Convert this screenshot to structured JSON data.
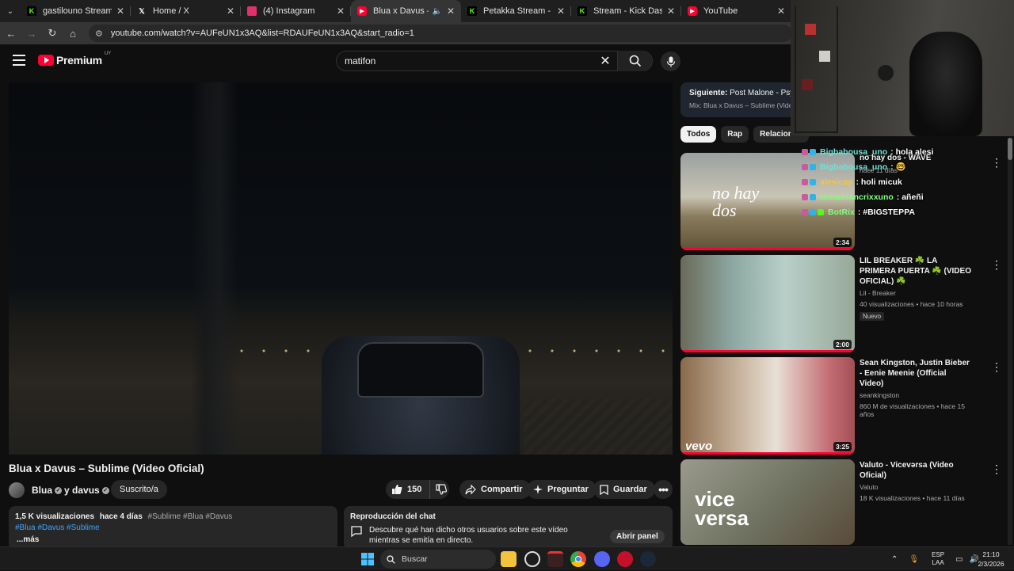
{
  "browser": {
    "tabs": [
      {
        "title": "gastilouno Stream - Watch",
        "icon": "kick-icon",
        "color": "#53fc18",
        "active": false
      },
      {
        "title": "Home / X",
        "icon": "x-icon",
        "color": "#ffffff",
        "active": false
      },
      {
        "title": "(4) Instagram",
        "icon": "instagram-icon",
        "color": "#e1306c",
        "active": false
      },
      {
        "title": "Blua x Davus – Sublime",
        "icon": "youtube-icon",
        "color": "#ff0033",
        "active": true
      },
      {
        "title": "Petakka Stream - Watch L",
        "icon": "kick-icon",
        "color": "#53fc18",
        "active": false
      },
      {
        "title": "Stream - Kick Dashboard",
        "icon": "kick-icon",
        "color": "#53fc18",
        "active": false
      },
      {
        "title": "YouTube",
        "icon": "youtube-icon",
        "color": "#ff0033",
        "active": false
      }
    ],
    "url": "youtube.com/watch?v=AUFeUN1x3AQ&list=RDAUFeUN1x3AQ&start_radio=1"
  },
  "header": {
    "logo_text": "Premium",
    "country_code": "UY",
    "search_query": "matifon"
  },
  "video": {
    "title": "Blua x Davus – Sublime (Video Oficial)",
    "channel": "Blua",
    "channel_joiner": "y davus",
    "subscribed_label": "Suscrito/a",
    "likes": "150",
    "share_label": "Compartir",
    "ask_label": "Preguntar",
    "save_label": "Guardar"
  },
  "description": {
    "views": "1,5 K visualizaciones",
    "age": "hace 4 días",
    "tags_inline": "#Sublime #Blua #Davus",
    "tags_links": "#Blua #Davus #Sublime",
    "more_label": "...más"
  },
  "chat_replay": {
    "heading": "Reproducción del chat",
    "text": "Descubre qué han dicho otros usuarios sobre este vídeo mientras se emitía en directo.",
    "button": "Abrir panel"
  },
  "up_next": {
    "label": "Siguiente:",
    "title": "Post Malone - Psych",
    "mix": "Mix: Blua x Davus – Sublime (Video"
  },
  "chips": [
    "Todos",
    "Rap",
    "Relacionad"
  ],
  "recommendations": [
    {
      "title": "no hay dos - WAVE",
      "channel": "",
      "views": "",
      "age": "hace 11 días",
      "duration": "2:34",
      "badge": "",
      "thumb_text": "no hay dos"
    },
    {
      "title": "LIL BREAKER ☘️ LA PRIMERA PUERTA ☘️ (VIDEO OFICIAL) ☘️",
      "channel": "Lil - Breaker",
      "views": "40 visualizaciones",
      "age": "hace 10 horas",
      "duration": "2:00",
      "badge": "Nuevo",
      "thumb_text": ""
    },
    {
      "title": "Sean Kingston, Justin Bieber - Eenie Meenie (Official Video)",
      "channel": "seankingston",
      "views": "860 M de visualizaciones",
      "age": "hace 15 años",
      "duration": "3:25",
      "badge": "",
      "thumb_text": "vevo"
    },
    {
      "title": "Valuto - Vicevərsa (Video Oficial)",
      "channel": "Valuto",
      "views": "18 K visualizaciones",
      "age": "hace 11 días",
      "duration": "",
      "badge": "",
      "thumb_text": "vice versa"
    }
  ],
  "stream_chat": [
    {
      "user": "Bigbabousa_uno",
      "msg": ": hola alesi",
      "color": "#6fe2d6"
    },
    {
      "user": "Bigbabousa_uno",
      "msg": ": 🤓",
      "color": "#6fe2d6"
    },
    {
      "user": "alesicap",
      "msg": ": holi micuk",
      "color": "#f5c542"
    },
    {
      "user": "tomassancrixxuno",
      "msg": ": añeñi",
      "color": "#7cff7a"
    },
    {
      "user": "BotRix",
      "msg": ": #BIGSTEPPA",
      "color": "#7cff7a"
    }
  ],
  "taskbar": {
    "search_label": "Buscar",
    "lang_top": "ESP",
    "lang_bottom": "LAA",
    "time": "21:10",
    "date": "2/3/2026"
  }
}
